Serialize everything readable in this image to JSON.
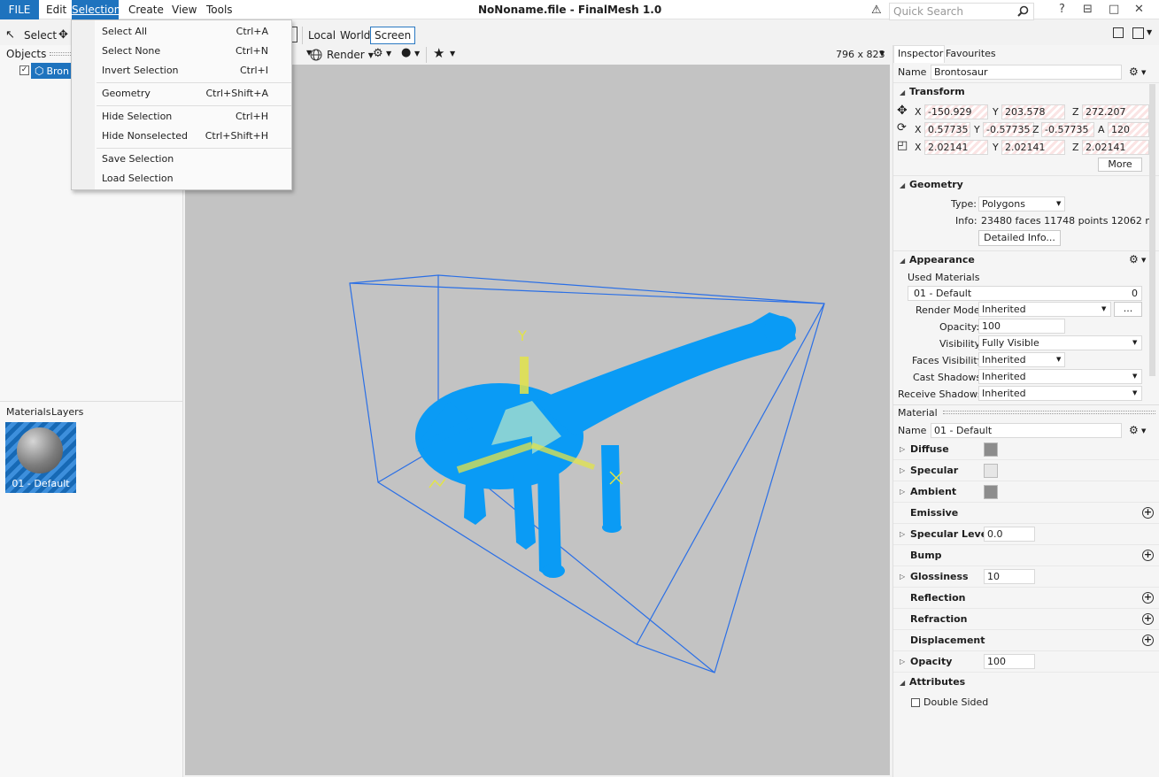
{
  "menubar": {
    "file": "FILE",
    "items": [
      "Edit",
      "Selection",
      "Create",
      "View",
      "Tools"
    ],
    "title": "NoNoname.file - FinalMesh 1.0",
    "quick_search_placeholder": "Quick Search",
    "help": "?",
    "minimize": "⊟",
    "restore": "□",
    "close": "✕"
  },
  "toolbar": {
    "select_label": "Select",
    "coord_local": "Local",
    "coord_world": "World",
    "coord_screen": "Screen",
    "render_label": "Render",
    "viewport_size": "796 x 823"
  },
  "left": {
    "objects_label": "Objects",
    "object_name": "Bron",
    "materials_tab": "Materials",
    "layers_tab": "Layers",
    "material_thumb_label": "01 - Default"
  },
  "selection_menu": [
    {
      "label": "Select All",
      "shortcut": "Ctrl+A"
    },
    {
      "label": "Select None",
      "shortcut": "Ctrl+N"
    },
    {
      "label": "Invert Selection",
      "shortcut": "Ctrl+I"
    },
    {
      "label": "Geometry",
      "shortcut": "Ctrl+Shift+A"
    },
    {
      "label": "Hide Selection",
      "shortcut": "Ctrl+H"
    },
    {
      "label": "Hide Nonselected",
      "shortcut": "Ctrl+Shift+H"
    },
    {
      "label": "Save Selection",
      "shortcut": ""
    },
    {
      "label": "Load Selection",
      "shortcut": ""
    }
  ],
  "inspector": {
    "tab_inspector": "Inspector",
    "tab_favourites": "Favourites",
    "name_label": "Name",
    "name_value": "Brontosaur",
    "transform_title": "Transform",
    "position": {
      "x": "-150.929",
      "y": "203.578",
      "z": "272.207"
    },
    "rotation": {
      "x": "0.57735",
      "y": "-0.57735",
      "z": "-0.57735",
      "a": "120"
    },
    "scale": {
      "x": "2.02141",
      "y": "2.02141",
      "z": "2.02141"
    },
    "axis_x": "X",
    "axis_y": "Y",
    "axis_z": "Z",
    "axis_a": "A",
    "more_button": "More",
    "geometry_title": "Geometry",
    "type_label": "Type:",
    "type_value": "Polygons",
    "info_label": "Info:",
    "info_value": "23480 faces 11748 points 12062 n",
    "detailed_info_button": "Detailed Info...",
    "appearance_title": "Appearance",
    "used_materials_label": "Used Materials",
    "used_material": "01 - Default",
    "used_material_count": "0",
    "render_mode_label": "Render Mode:",
    "render_mode_value": "Inherited",
    "ellipsis_button": "...",
    "opacity_label": "Opacity:",
    "opacity_value": "100",
    "visibility_label": "Visibility:",
    "visibility_value": "Fully Visible",
    "faces_visibility_label": "Faces Visibility:",
    "faces_visibility_value": "Inherited",
    "cast_shadows_label": "Cast Shadows:",
    "cast_shadows_value": "Inherited",
    "receive_shadows_label": "Receive Shadows:",
    "receive_shadows_value": "Inherited"
  },
  "material": {
    "title": "Material",
    "name_label": "Name",
    "name_value": "01 - Default",
    "rows": [
      {
        "label": "Diffuse",
        "expand": true,
        "kind": "swatch",
        "value": "#8c8c8c"
      },
      {
        "label": "Specular",
        "expand": true,
        "kind": "swatch",
        "value": "#e6e6e6"
      },
      {
        "label": "Ambient",
        "expand": true,
        "kind": "swatch",
        "value": "#8c8c8c"
      },
      {
        "label": "Emissive",
        "expand": false,
        "kind": "plus",
        "value": ""
      },
      {
        "label": "Specular Level",
        "expand": true,
        "kind": "spin",
        "value": "0.0"
      },
      {
        "label": "Bump",
        "expand": false,
        "kind": "plus",
        "value": ""
      },
      {
        "label": "Glossiness",
        "expand": true,
        "kind": "spin",
        "value": "10"
      },
      {
        "label": "Reflection",
        "expand": false,
        "kind": "plus",
        "value": ""
      },
      {
        "label": "Refraction",
        "expand": false,
        "kind": "plus",
        "value": ""
      },
      {
        "label": "Displacement",
        "expand": false,
        "kind": "plus",
        "value": ""
      },
      {
        "label": "Opacity",
        "expand": true,
        "kind": "spin",
        "value": "100"
      }
    ],
    "attributes_title": "Attributes",
    "double_sided_label": "Double Sided"
  },
  "viewport": {
    "gizmo_axis_label": "Y",
    "background": "#c3c3c3",
    "model_color": "#0a9bf5",
    "bbox_color": "#2a6fe6"
  }
}
